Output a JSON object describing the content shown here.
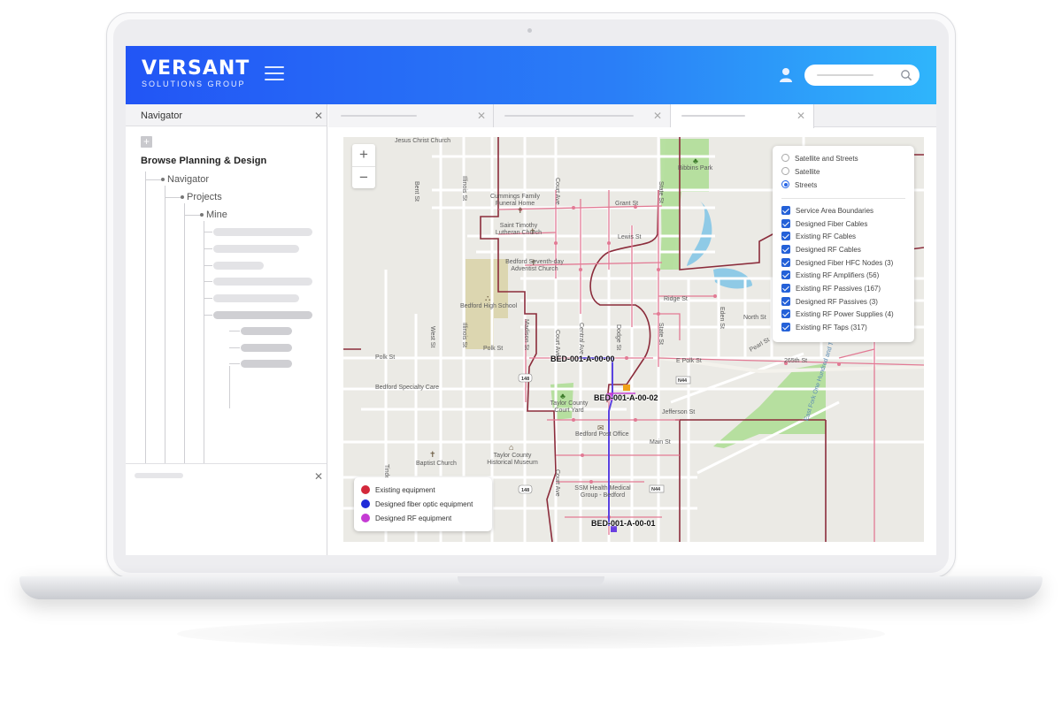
{
  "header": {
    "logo_main": "VERSANT",
    "logo_sub": "SOLUTIONS GROUP",
    "menu_icon": "hamburger-menu-icon",
    "user_icon": "user-icon",
    "search_icon": "search-icon"
  },
  "navigator": {
    "title": "Navigator",
    "root": "Browse Planning & Design",
    "tree": [
      "Navigator",
      "Projects",
      "Mine"
    ]
  },
  "map": {
    "zoom_in": "+",
    "zoom_out": "−",
    "base_layers": [
      {
        "label": "Satellite and Streets",
        "selected": false
      },
      {
        "label": "Satellite",
        "selected": false
      },
      {
        "label": "Streets",
        "selected": true
      }
    ],
    "overlays": [
      {
        "label": "Service Area Boundaries",
        "checked": true
      },
      {
        "label": "Designed Fiber Cables",
        "checked": true
      },
      {
        "label": "Existing RF Cables",
        "checked": true
      },
      {
        "label": "Designed RF Cables",
        "checked": true
      },
      {
        "label": "Designed Fiber HFC Nodes (3)",
        "checked": true
      },
      {
        "label": "Existing RF Amplifiers (56)",
        "checked": true
      },
      {
        "label": "Existing RF Passives (167)",
        "checked": true
      },
      {
        "label": "Designed RF Passives (3)",
        "checked": true
      },
      {
        "label": "Existing RF Power Supplies (4)",
        "checked": true
      },
      {
        "label": "Existing RF Taps (317)",
        "checked": true
      }
    ],
    "legend": [
      {
        "label": "Existing equipment",
        "color": "#d3283b"
      },
      {
        "label": "Designed fiber optic equipment",
        "color": "#1f2bd8"
      },
      {
        "label": "Designed RF equipment",
        "color": "#c53bd4"
      }
    ],
    "equipment_labels": [
      "BED-001-A-00-00",
      "BED-001-A-00-02",
      "BED-001-A-00-01"
    ],
    "place_labels": [
      "Jesus Christ Church",
      "Bibbins Park",
      "Cummings Family Funeral Home",
      "Saint Timothy Lutheran Church",
      "Bedford Seventh-day Adventist Church",
      "Bedford High School",
      "Bedford Specialty Care",
      "Taylor County Court Yard",
      "Bedford Post Office",
      "Baptist Church",
      "Taylor County Historical Museum",
      "SSM Health Medical Group - Bedford"
    ],
    "street_labels": [
      "Grant St",
      "Lewis St",
      "Ridge St",
      "North St",
      "Polk St",
      "E Polk St",
      "265th St",
      "Pearl St",
      "Jefferson St",
      "Main St",
      "Bent St",
      "Illinois St",
      "Court Ave",
      "State St",
      "West St",
      "Madison St",
      "Central Ave",
      "Dodge St",
      "Eden St",
      "Tinder St",
      "Pearl Ave",
      "East Fork One Hundred and Two River"
    ],
    "road_shields": [
      "148",
      "148",
      "N44",
      "N44"
    ]
  }
}
